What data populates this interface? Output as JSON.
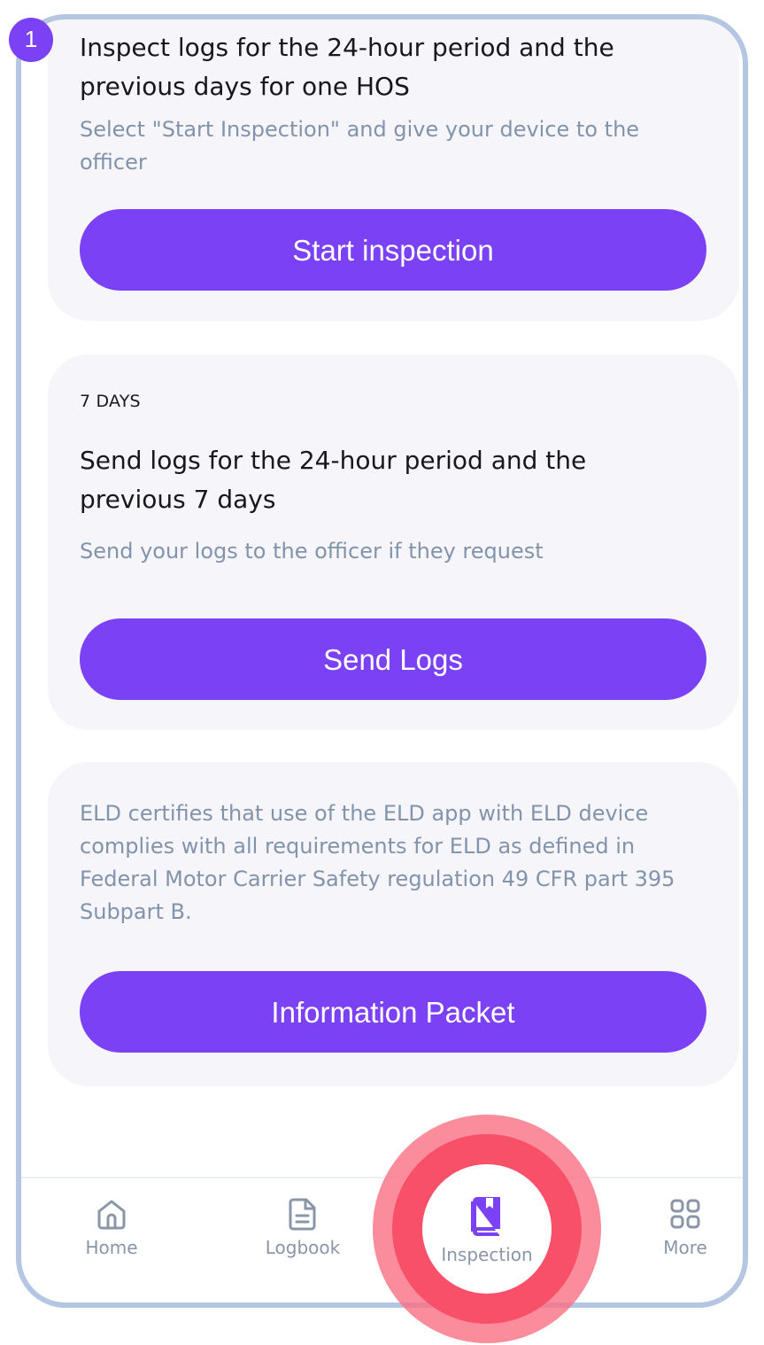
{
  "step_badge": "1",
  "colors": {
    "accent": "#7b41f4",
    "card_bg": "#f6f5fa",
    "frame": "#b5c6e3",
    "highlight": "#f9506a",
    "muted_text": "#8293ac"
  },
  "inspection_card": {
    "title": "Inspect logs for the 24-hour period and the previous days for one HOS",
    "subtitle": "Select \"Start Inspection\" and give your device to the officer",
    "button": "Start inspection"
  },
  "send_card": {
    "kicker": "7 DAYS",
    "title": "Send logs for the 24-hour period and the previous 7 days",
    "subtitle": "Send your logs to the officer if they request",
    "button": "Send Logs"
  },
  "info_card": {
    "text": "ELD certifies that use of the ELD app with ELD device complies with all requirements for ELD as defined in Federal Motor Carrier Safety regulation 49 CFR part 395 Subpart B.",
    "button": "Information Packet"
  },
  "nav": [
    {
      "label": "Home",
      "icon": "home-icon"
    },
    {
      "label": "Logbook",
      "icon": "document-icon"
    },
    {
      "label": "Inspection",
      "icon": "book-icon",
      "active": true
    },
    {
      "label": "More",
      "icon": "grid-icon"
    }
  ]
}
